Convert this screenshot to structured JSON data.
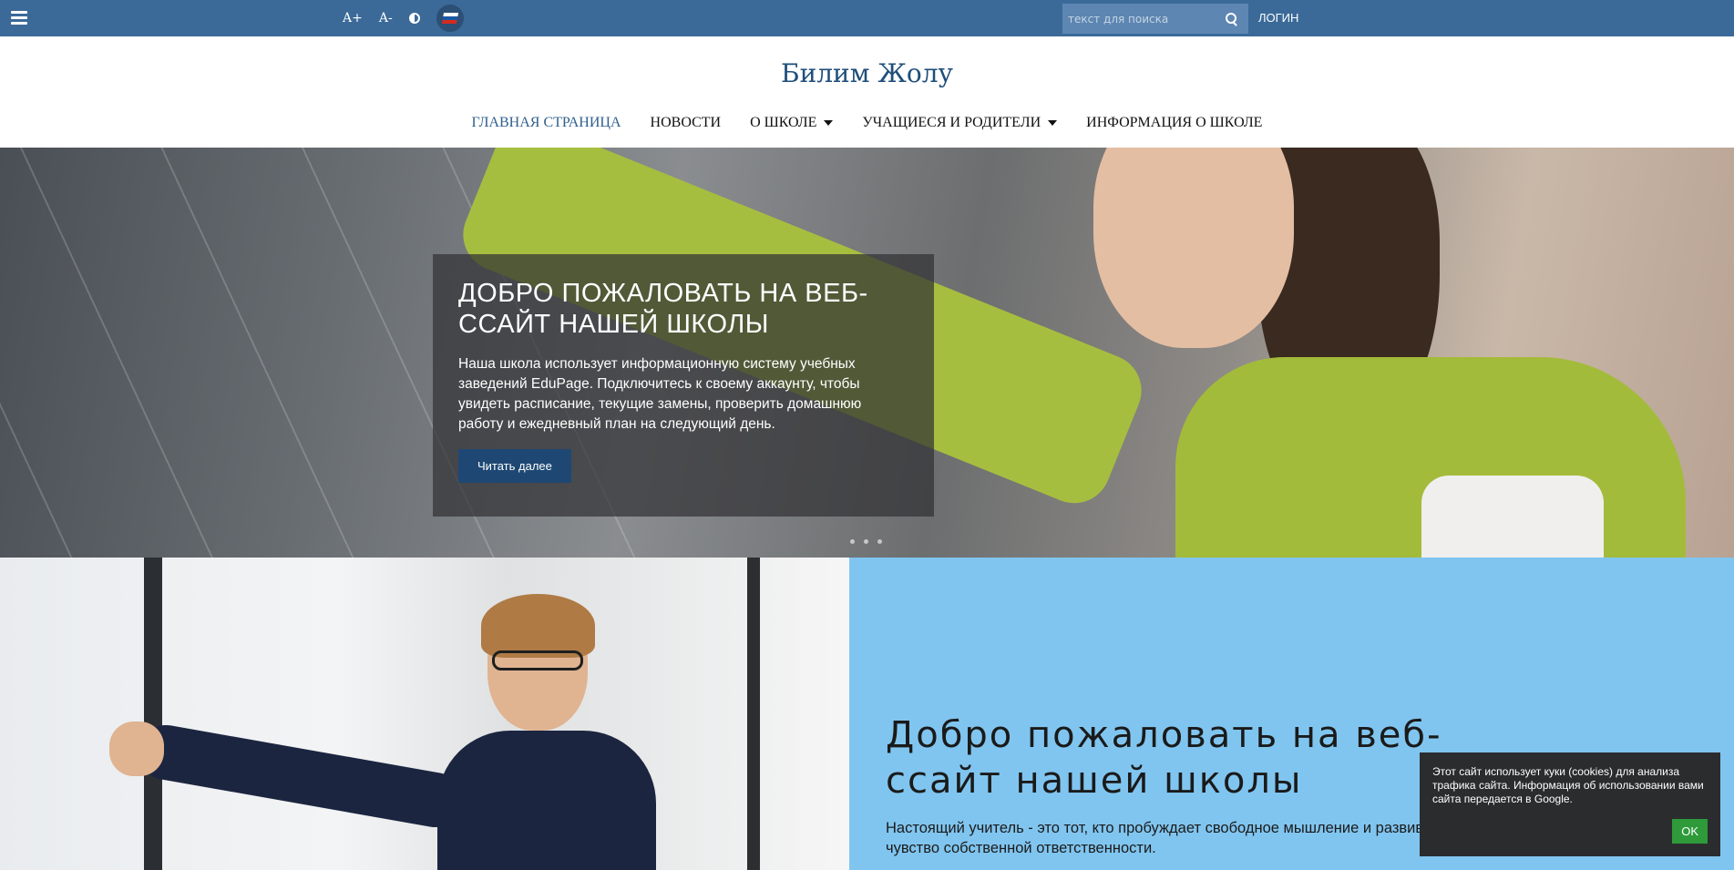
{
  "topbar": {
    "font_increase": "A+",
    "font_decrease": "A-",
    "search_placeholder": "текст для поиска",
    "login_label": "ЛОГИН",
    "flag_colors": [
      "#ffffff",
      "#1c57a5",
      "#d52b1e"
    ]
  },
  "header": {
    "site_title": "Билим Жолу",
    "nav": [
      {
        "label": "ГЛАВНАЯ СТРАНИЦА",
        "active": true
      },
      {
        "label": "НОВОСТИ"
      },
      {
        "label": "О ШКОЛЕ",
        "dropdown": true
      },
      {
        "label": "УЧАЩИЕСЯ И РОДИТЕЛИ",
        "dropdown": true
      },
      {
        "label": "ИНФОРМАЦИЯ О ШКОЛЕ"
      }
    ]
  },
  "hero": {
    "title": "ДОБРО ПОЖАЛОВАТЬ НА ВЕБ-ССАЙТ НАШЕЙ ШКОЛЫ",
    "text": "Наша школа использует информационную систему учебных заведений EduPage. Подключитесь к своему аккаунту, чтобы увидеть расписание, текущие замены, проверить домашнюю работу и ежедневный план на следующий день.",
    "button_label": "Читать далее",
    "slide_count": 3
  },
  "section": {
    "title": "Добро пожаловать на веб-ссайт нашей школы",
    "text": "Настоящий учитель - это тот, кто пробуждает свободное мышление и развивает чувство собственной ответственности."
  },
  "cookie": {
    "text": "Этот сайт использует куки (cookies) для анализа трафика сайта. Информация об использовании вами сайта передается в Google.",
    "ok_label": "OK"
  },
  "colors": {
    "topbar": "#3b6a99",
    "title": "#1f4e7a",
    "button": "#1e4873",
    "section_bg": "#80c5ef",
    "cookie_ok": "#2e9a3a"
  }
}
